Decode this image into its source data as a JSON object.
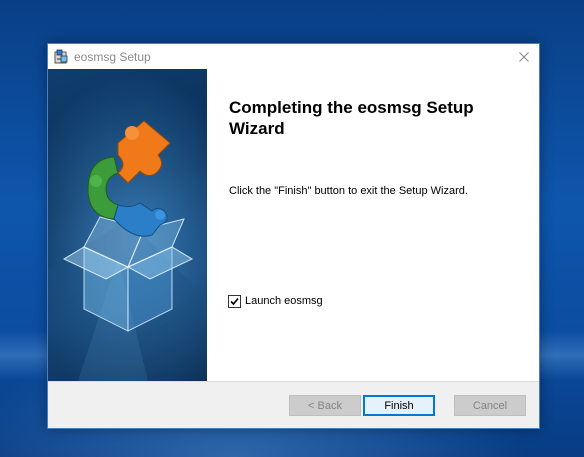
{
  "window": {
    "title": "eosmsg Setup",
    "close_symbol": "✕"
  },
  "content": {
    "heading": "Completing the eosmsg Setup Wizard",
    "info": "Click the \"Finish\" button to exit the Setup Wizard.",
    "launch_checkbox": {
      "label": "Launch eosmsg",
      "checked": true
    }
  },
  "buttons": {
    "back": {
      "label": "< Back",
      "enabled": false
    },
    "finish": {
      "label": "Finish",
      "enabled": true,
      "default": true
    },
    "cancel": {
      "label": "Cancel",
      "enabled": false
    }
  },
  "icons": {
    "title": "installer-icon",
    "close": "close-icon",
    "banner_logo": "puzzle-box-logo",
    "checkbox_mark": "checkmark-icon"
  },
  "colors": {
    "accent": "#0078d7",
    "puzzle_orange": "#f07a1a",
    "puzzle_green": "#3d9c3a",
    "puzzle_blue": "#2a7fc8",
    "banner_dark": "#0a2f57"
  }
}
